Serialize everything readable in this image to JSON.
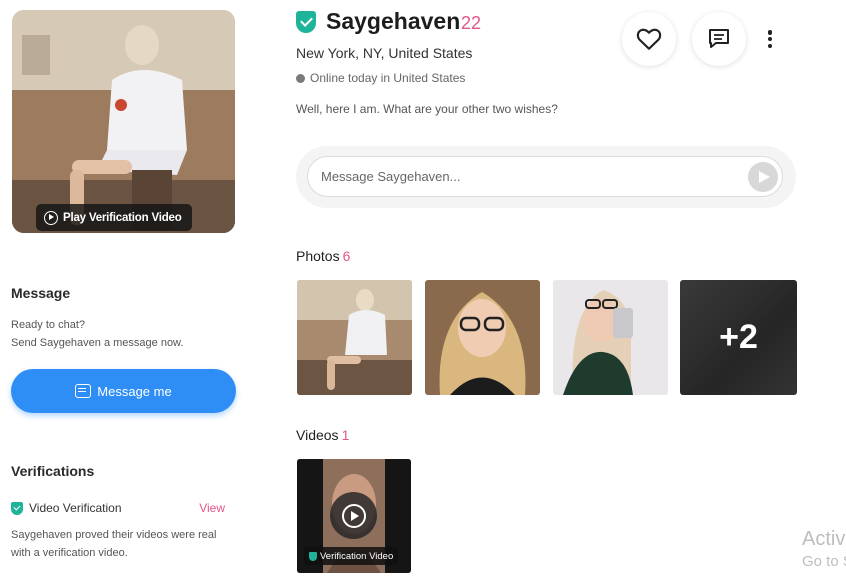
{
  "profile": {
    "name": "Saygehaven",
    "age": "22",
    "location": "New York, NY, United States",
    "status": "Online today in United States",
    "bio": "Well, here I am. What are your other two wishes?",
    "play_verification_label": "Play Verification Video"
  },
  "sidebar": {
    "message_heading": "Message",
    "message_line1": "Ready to chat?",
    "message_line2": "Send Saygehaven a message now.",
    "message_button": "Message me",
    "verifications_heading": "Verifications",
    "verification_label": "Video Verification",
    "verification_view": "View",
    "verification_desc_line1": "Saygehaven proved their videos were real",
    "verification_desc_line2": "with a verification video."
  },
  "actions": {
    "like_icon": "heart-icon",
    "chat_icon": "chat-icon",
    "more_icon": "more-vertical-icon"
  },
  "message_box": {
    "placeholder": "Message Saygehaven...",
    "send_icon": "send-icon"
  },
  "photos": {
    "title": "Photos",
    "count": "6",
    "more_label": "+2"
  },
  "videos": {
    "title": "Videos",
    "count": "1",
    "badge": "Verification Video"
  },
  "watermark": {
    "line1": "Activ",
    "line2": "Go to S"
  },
  "colors": {
    "accent_pink": "#e2568e",
    "primary_blue": "#2f8ef5",
    "verified_green": "#1fb39a"
  }
}
